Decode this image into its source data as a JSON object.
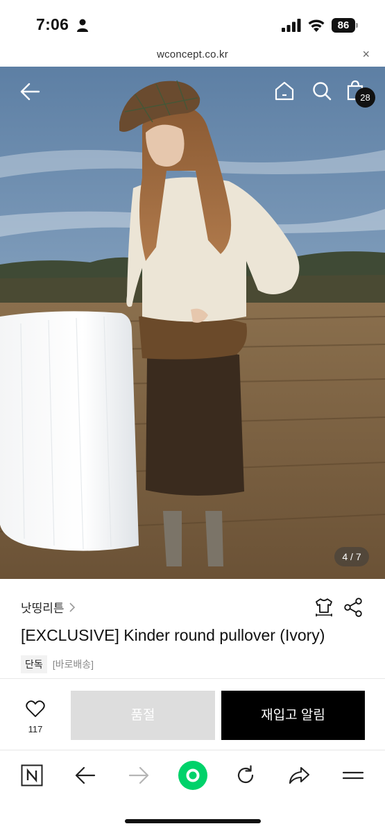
{
  "status_bar": {
    "time": "7:06",
    "battery": "86"
  },
  "browser": {
    "url": "wconcept.co.kr",
    "close_label": "×"
  },
  "hero": {
    "cart_count": "28",
    "image_counter": "4 / 7"
  },
  "product": {
    "brand": "낫띵리튼",
    "title": "[EXCLUSIVE] Kinder round pullover (Ivory)",
    "tags": {
      "exclusive": "단독",
      "shipping": "[바로배송]"
    }
  },
  "actions": {
    "like_count": "117",
    "soldout_label": "품절",
    "restock_label": "재입고 알림"
  },
  "colors": {
    "accent_green": "#00d26a",
    "black": "#000000",
    "soldout_gray": "#dddddd"
  }
}
